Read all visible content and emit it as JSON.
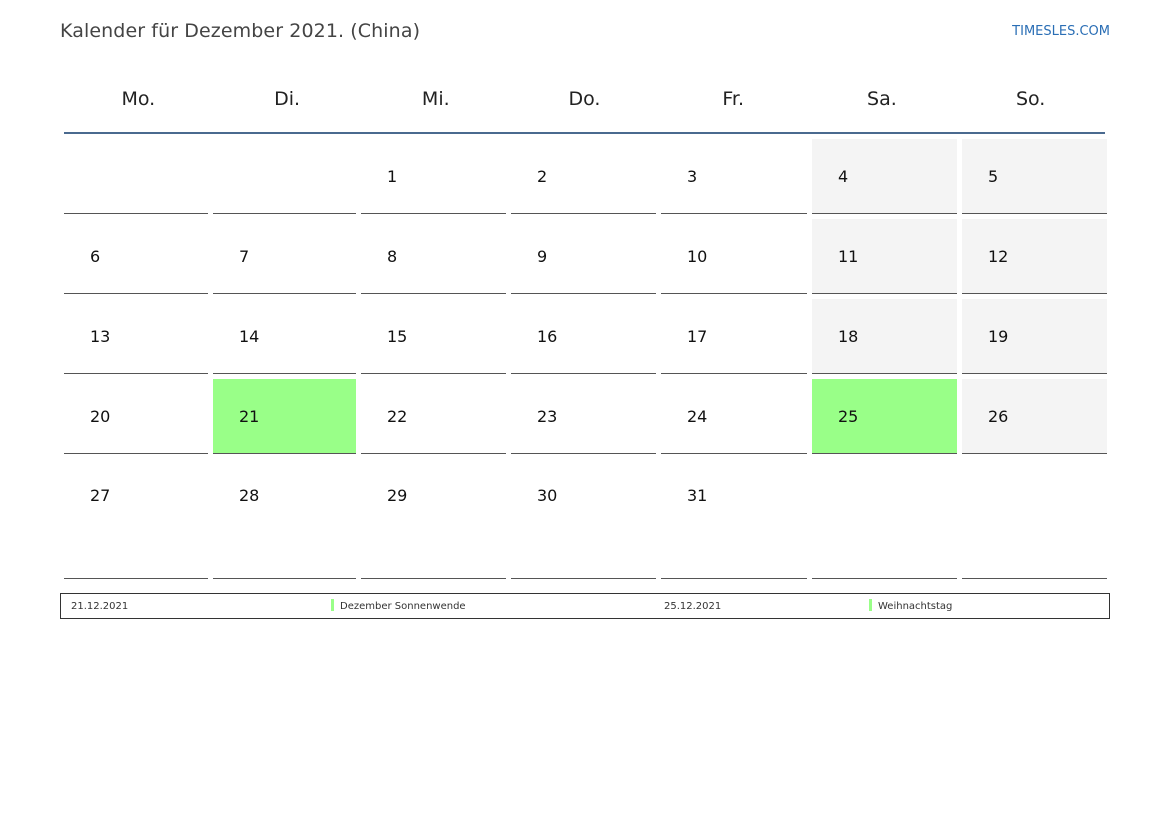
{
  "header": {
    "title": "Kalender für Dezember 2021. (China)",
    "site": "TIMESLES.COM"
  },
  "weekdays": [
    "Mo.",
    "Di.",
    "Mi.",
    "Do.",
    "Fr.",
    "Sa.",
    "So."
  ],
  "weeks": [
    [
      "",
      "",
      "1",
      "2",
      "3",
      "4",
      "5"
    ],
    [
      "6",
      "7",
      "8",
      "9",
      "10",
      "11",
      "12"
    ],
    [
      "13",
      "14",
      "15",
      "16",
      "17",
      "18",
      "19"
    ],
    [
      "20",
      "21",
      "22",
      "23",
      "24",
      "25",
      "26"
    ],
    [
      "27",
      "28",
      "29",
      "30",
      "31",
      "",
      ""
    ]
  ],
  "holidays": [
    {
      "date": "21.12.2021",
      "name": "Dezember Sonnenwende"
    },
    {
      "date": "25.12.2021",
      "name": "Weihnachtstag"
    }
  ],
  "colors": {
    "holiday": "#99ff88",
    "weekend": "#f4f4f4",
    "header_rule": "#4a6a8f",
    "link": "#2a6eb5"
  }
}
